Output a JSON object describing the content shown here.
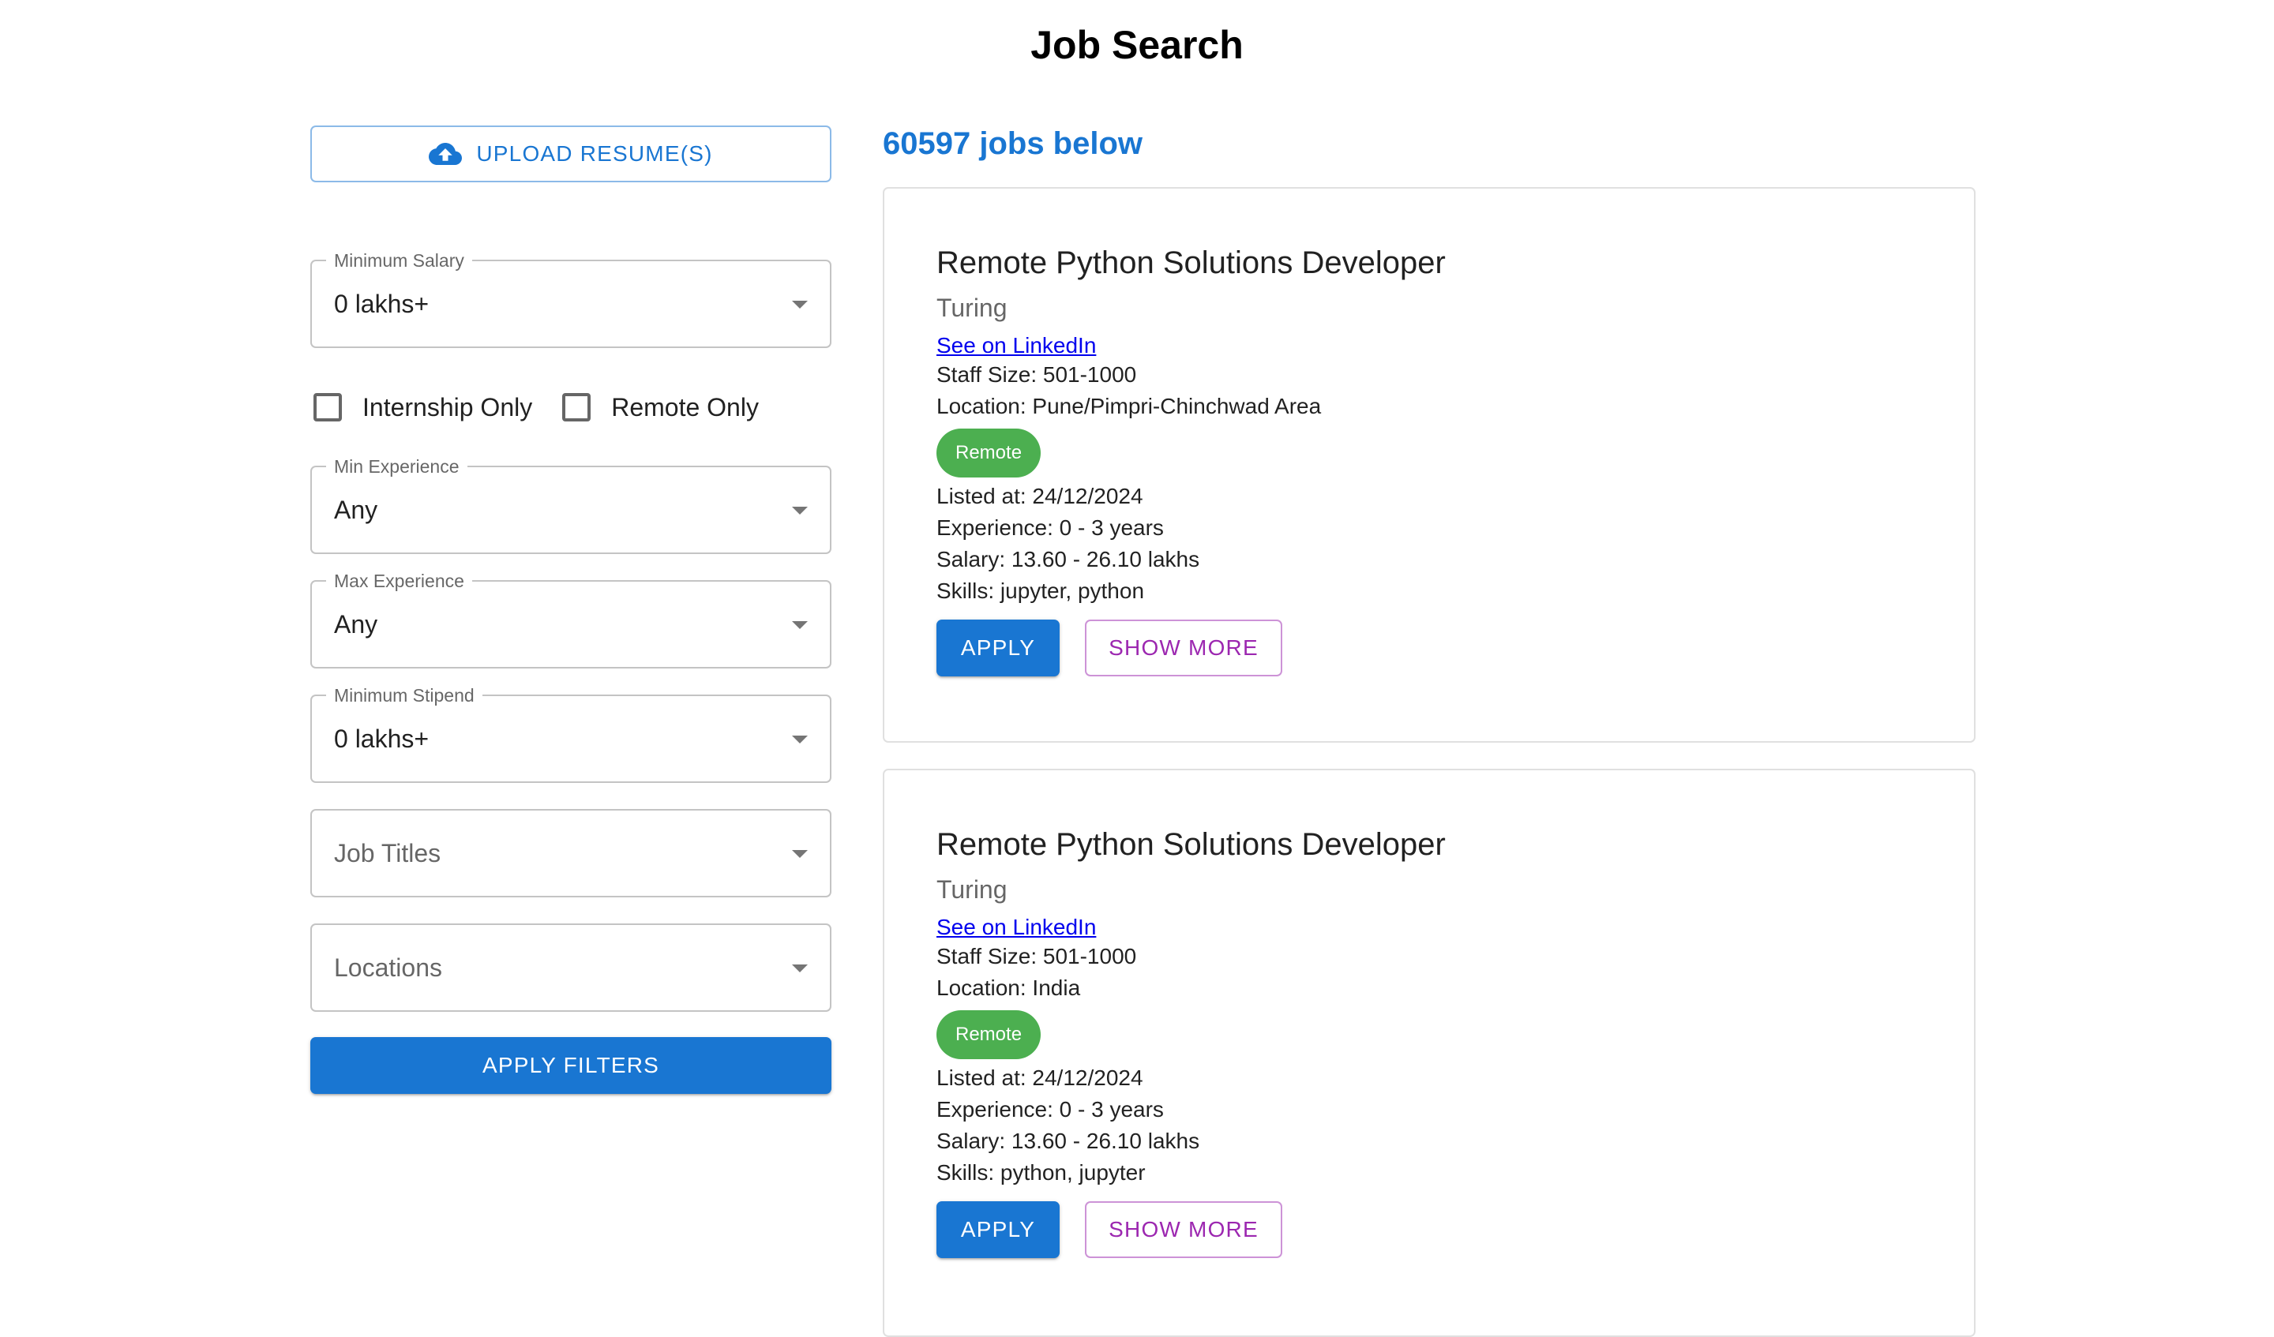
{
  "page": {
    "title": "Job Search"
  },
  "filters": {
    "upload_label": "UPLOAD RESUME(S)",
    "min_salary": {
      "label": "Minimum Salary",
      "value": "0 lakhs+"
    },
    "internship_only": {
      "label": "Internship Only",
      "checked": false
    },
    "remote_only": {
      "label": "Remote Only",
      "checked": false
    },
    "min_experience": {
      "label": "Min Experience",
      "value": "Any"
    },
    "max_experience": {
      "label": "Max Experience",
      "value": "Any"
    },
    "min_stipend": {
      "label": "Minimum Stipend",
      "value": "0 lakhs+"
    },
    "job_titles": {
      "placeholder": "Job Titles"
    },
    "locations": {
      "placeholder": "Locations"
    },
    "apply_label": "APPLY FILTERS"
  },
  "results": {
    "count_text": "60597 jobs below",
    "jobs": [
      {
        "title": "Remote Python Solutions Developer",
        "company": "Turing",
        "link_text": "See on LinkedIn",
        "staff_size": "Staff Size: 501-1000",
        "location": "Location: Pune/Pimpri-Chinchwad Area",
        "badge": "Remote",
        "listed_at": "Listed at: 24/12/2024",
        "experience": "Experience: 0 - 3 years",
        "salary": "Salary: 13.60 - 26.10 lakhs",
        "skills": "Skills: jupyter, python",
        "apply_label": "APPLY",
        "more_label": "SHOW MORE"
      },
      {
        "title": "Remote Python Solutions Developer",
        "company": "Turing",
        "link_text": "See on LinkedIn",
        "staff_size": "Staff Size: 501-1000",
        "location": "Location: India",
        "badge": "Remote",
        "listed_at": "Listed at: 24/12/2024",
        "experience": "Experience: 0 - 3 years",
        "salary": "Salary: 13.60 - 26.10 lakhs",
        "skills": "Skills: python, jupyter",
        "apply_label": "APPLY",
        "more_label": "SHOW MORE"
      }
    ]
  },
  "colors": {
    "primary": "#1976d2",
    "secondary": "#9c27b0",
    "remote_badge": "#4caf50",
    "link": "#0000ee"
  },
  "icons": {
    "upload": "cloud-upload-icon",
    "dropdown": "arrow-drop-down-icon"
  }
}
